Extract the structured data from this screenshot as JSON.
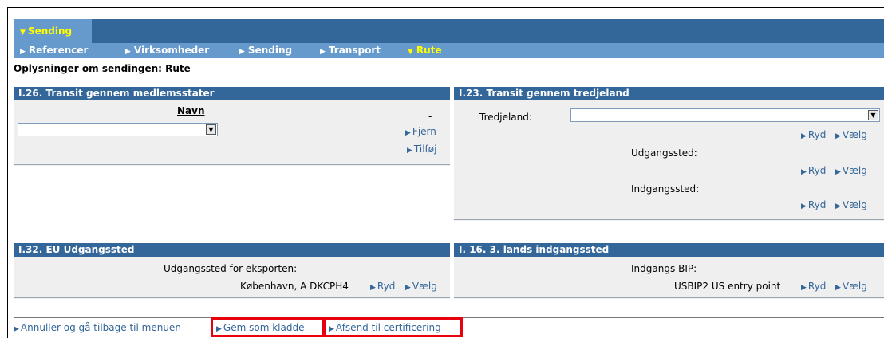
{
  "nav": {
    "top_tab": "Sending",
    "sub_items": [
      {
        "label": "Referencer",
        "active": false
      },
      {
        "label": "Virksomheder",
        "active": false
      },
      {
        "label": "Sending",
        "active": false
      },
      {
        "label": "Transport",
        "active": false
      },
      {
        "label": "Rute",
        "active": true
      }
    ]
  },
  "page_heading": "Oplysninger om sendingen: Rute",
  "panel_member_states": {
    "title": "I.26. Transit gennem medlemsstater",
    "column_header": "Navn",
    "column_dash": "-",
    "select_value": "",
    "remove_link": "Fjern",
    "add_link": "Tilføj"
  },
  "panel_third_countries": {
    "title": "I.23. Transit gennem tredjeland",
    "country_label": "Tredjeland:",
    "country_value": "",
    "clear_link": "Ryd",
    "choose_link": "Vælg",
    "exit_label": "Udgangssted:",
    "entry_label": "Indgangssted:"
  },
  "panel_eu_exit": {
    "title": "I.32. EU Udgangssted",
    "label": "Udgangssted for eksporten:",
    "value": "København, A DKCPH4",
    "clear_link": "Ryd",
    "choose_link": "Vælg"
  },
  "panel_third_entry": {
    "title": "I. 16. 3. lands indgangssted",
    "label": "Indgangs-BIP:",
    "value": "USBIP2 US entry point",
    "clear_link": "Ryd",
    "choose_link": "Vælg"
  },
  "footer": {
    "cancel_link": "Annuller og gå tilbage til menuen",
    "save_draft_link": "Gem som kladde",
    "submit_link": "Afsend til certificering"
  },
  "colors": {
    "nav_dark": "#336699",
    "nav_light": "#6699cc",
    "active_text": "#ffff00",
    "panel_bg": "#efefef",
    "link": "#336699",
    "highlight": "#e8000d"
  }
}
